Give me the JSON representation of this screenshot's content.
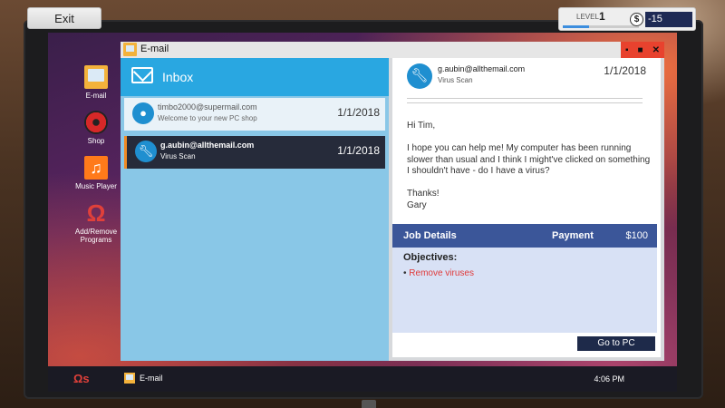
{
  "exit_label": "Exit",
  "status": {
    "level_label": "LEVEL",
    "level_value": "1",
    "level_progress": 0.35,
    "coin_symbol": "$",
    "money": "-15"
  },
  "desktop_icons": [
    {
      "label": "E-mail",
      "icon": "email-icon"
    },
    {
      "label": "Shop",
      "icon": "shop-icon"
    },
    {
      "label": "Music Player",
      "icon": "music-icon"
    },
    {
      "label": "Add/Remove Programs",
      "icon": "add-remove-icon"
    }
  ],
  "window": {
    "title": "E-mail",
    "controls": [
      "minimize",
      "maximize",
      "close"
    ]
  },
  "inbox": {
    "title": "Inbox",
    "emails": [
      {
        "from": "timbo2000@supermail.com",
        "subject": "Welcome to your new PC shop",
        "date": "1/1/2018",
        "avatar": "person-icon"
      },
      {
        "from": "g.aubin@allthemail.com",
        "subject": "Virus Scan",
        "date": "1/1/2018",
        "avatar": "wrench-icon"
      }
    ]
  },
  "reader": {
    "from": "g.aubin@allthemail.com",
    "subject": "Virus Scan",
    "date": "1/1/2018",
    "greeting": "Hi Tim,",
    "body": "I hope you can help me! My computer has been running slower than usual and I think I might've clicked on something I shouldn't have - do I have a virus?",
    "signoff": "Thanks!",
    "signature": "Gary",
    "job_details_label": "Job Details",
    "payment_label": "Payment",
    "payment_amount": "$100",
    "objectives_label": "Objectives:",
    "objectives": [
      "Remove viruses"
    ],
    "goto_button": "Go to PC"
  },
  "taskbar": {
    "start_icon": "start-icon",
    "start_label": "Ωs",
    "task_label": "E-mail",
    "clock": "4:06 PM"
  }
}
